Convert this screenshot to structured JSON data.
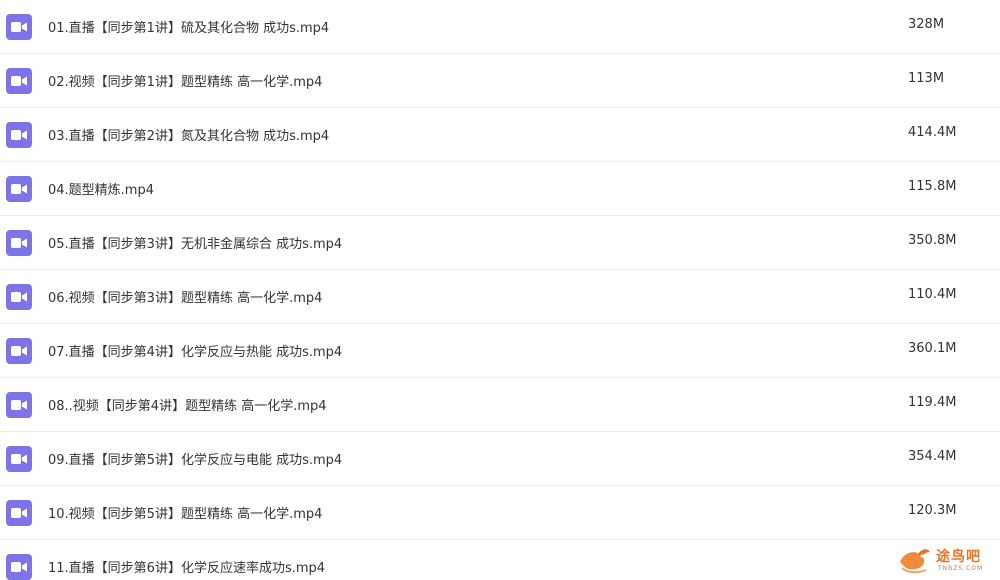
{
  "files": [
    {
      "name": "01.直播【同步第1讲】硫及其化合物 成功s.mp4",
      "size": "328M",
      "icon": "video-file-icon"
    },
    {
      "name": "02.视频【同步第1讲】题型精练 高一化学.mp4",
      "size": "113M",
      "icon": "video-file-icon"
    },
    {
      "name": "03.直播【同步第2讲】氮及其化合物 成功s.mp4",
      "size": "414.4M",
      "icon": "video-file-icon"
    },
    {
      "name": "04.题型精炼.mp4",
      "size": "115.8M",
      "icon": "video-file-icon"
    },
    {
      "name": "05.直播【同步第3讲】无机非金属综合 成功s.mp4",
      "size": "350.8M",
      "icon": "video-file-icon"
    },
    {
      "name": "06.视频【同步第3讲】题型精练 高一化学.mp4",
      "size": "110.4M",
      "icon": "video-file-icon"
    },
    {
      "name": "07.直播【同步第4讲】化学反应与热能 成功s.mp4",
      "size": "360.1M",
      "icon": "video-file-icon"
    },
    {
      "name": "08..视频【同步第4讲】题型精练 高一化学.mp4",
      "size": "119.4M",
      "icon": "video-file-icon"
    },
    {
      "name": "09.直播【同步第5讲】化学反应与电能 成功s.mp4",
      "size": "354.4M",
      "icon": "video-file-icon"
    },
    {
      "name": "10.视频【同步第5讲】题型精练 高一化学.mp4",
      "size": "120.3M",
      "icon": "video-file-icon"
    },
    {
      "name": "11.直播【同步第6讲】化学反应速率成功s.mp4",
      "size": "",
      "icon": "video-file-icon"
    }
  ],
  "watermark": {
    "text": "途鸟吧",
    "sub": "TNBZS.COM"
  },
  "colors": {
    "icon": "#7c74e8",
    "text": "#333333",
    "divider": "#ececec",
    "watermark": "#e8732a"
  }
}
